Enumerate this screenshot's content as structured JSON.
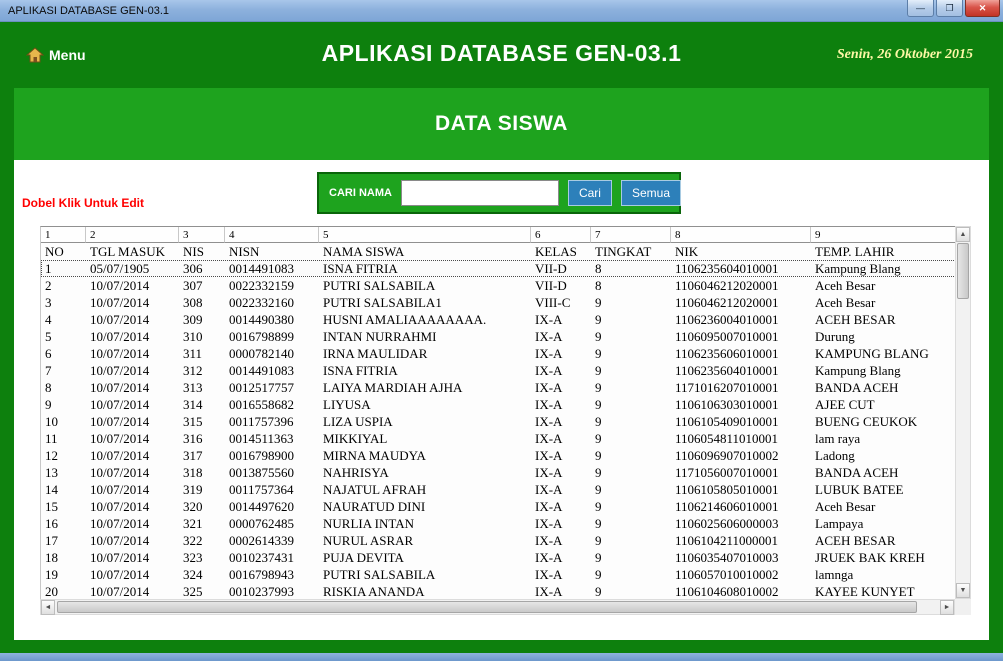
{
  "window": {
    "title": "APLIKASI DATABASE GEN-03.1",
    "controls": {
      "minimize": "—",
      "maximize": "❐",
      "close": "✕"
    }
  },
  "header": {
    "menu_label": "Menu",
    "title": "APLIKASI DATABASE GEN-03.1",
    "date": "Senin, 26 Oktober 2015"
  },
  "page": {
    "title": "DATA SISWA",
    "edit_hint": "Dobel Klik Untuk Edit"
  },
  "search": {
    "label": "CARI NAMA",
    "value": "",
    "buttons": {
      "cari": "Cari",
      "semua": "Semua"
    }
  },
  "icons": {
    "scroll_up": "▲",
    "scroll_down": "▼",
    "scroll_left": "◄",
    "scroll_right": "►"
  },
  "grid": {
    "column_numbers": [
      "1",
      "2",
      "3",
      "4",
      "5",
      "6",
      "7",
      "8",
      "9"
    ],
    "headers": [
      "NO",
      "TGL MASUK",
      "NIS",
      "NISN",
      "NAMA SISWA",
      "KELAS",
      "TINGKAT",
      "NIK",
      "TEMP. LAHIR"
    ],
    "rows": [
      [
        "1",
        "05/07/1905",
        "306",
        "0014491083",
        "ISNA FITRIA",
        "VII-D",
        "8",
        "1106235604010001",
        "Kampung Blang"
      ],
      [
        "2",
        "10/07/2014",
        "307",
        "0022332159",
        "PUTRI SALSABILA",
        "VII-D",
        "8",
        "1106046212020001",
        "Aceh Besar"
      ],
      [
        "3",
        "10/07/2014",
        "308",
        "0022332160",
        "PUTRI SALSABILA1",
        "VIII-C",
        "9",
        "1106046212020001",
        "Aceh Besar"
      ],
      [
        "4",
        "10/07/2014",
        "309",
        "0014490380",
        "HUSNI AMALIAAAAAAAA.",
        "IX-A",
        "9",
        "1106236004010001",
        "ACEH BESAR"
      ],
      [
        "5",
        "10/07/2014",
        "310",
        "0016798899",
        "INTAN NURRAHMI",
        "IX-A",
        "9",
        "1106095007010001",
        "Durung"
      ],
      [
        "6",
        "10/07/2014",
        "311",
        "0000782140",
        "IRNA MAULIDAR",
        "IX-A",
        "9",
        "1106235606010001",
        "KAMPUNG BLANG"
      ],
      [
        "7",
        "10/07/2014",
        "312",
        "0014491083",
        "ISNA FITRIA",
        "IX-A",
        "9",
        "1106235604010001",
        "Kampung Blang"
      ],
      [
        "8",
        "10/07/2014",
        "313",
        "0012517757",
        "LAIYA MARDIAH AJHA",
        "IX-A",
        "9",
        "1171016207010001",
        "BANDA ACEH"
      ],
      [
        "9",
        "10/07/2014",
        "314",
        "0016558682",
        "LIYUSA",
        "IX-A",
        "9",
        "1106106303010001",
        "AJEE CUT"
      ],
      [
        "10",
        "10/07/2014",
        "315",
        "0011757396",
        "LIZA USPIA",
        "IX-A",
        "9",
        "1106105409010001",
        "BUENG CEUKOK"
      ],
      [
        "11",
        "10/07/2014",
        "316",
        "0014511363",
        "MIKKIYAL",
        "IX-A",
        "9",
        "1106054811010001",
        "lam raya"
      ],
      [
        "12",
        "10/07/2014",
        "317",
        "0016798900",
        "MIRNA MAUDYA",
        "IX-A",
        "9",
        "1106096907010002",
        "Ladong"
      ],
      [
        "13",
        "10/07/2014",
        "318",
        "0013875560",
        "NAHRISYA",
        "IX-A",
        "9",
        "1171056007010001",
        "BANDA ACEH"
      ],
      [
        "14",
        "10/07/2014",
        "319",
        "0011757364",
        "NAJATUL AFRAH",
        "IX-A",
        "9",
        "1106105805010001",
        "LUBUK BATEE"
      ],
      [
        "15",
        "10/07/2014",
        "320",
        "0014497620",
        "NAURATUD DINI",
        "IX-A",
        "9",
        "1106214606010001",
        "Aceh Besar"
      ],
      [
        "16",
        "10/07/2014",
        "321",
        "0000762485",
        "NURLIA INTAN",
        "IX-A",
        "9",
        "1106025606000003",
        "Lampaya"
      ],
      [
        "17",
        "10/07/2014",
        "322",
        "0002614339",
        "NURUL ASRAR",
        "IX-A",
        "9",
        "1106104211000001",
        "ACEH BESAR"
      ],
      [
        "18",
        "10/07/2014",
        "323",
        "0010237431",
        "PUJA DEVITA",
        "IX-A",
        "9",
        "1106035407010003",
        "JRUEK BAK KREH"
      ],
      [
        "19",
        "10/07/2014",
        "324",
        "0016798943",
        "PUTRI SALSABILA",
        "IX-A",
        "9",
        "1106057010010002",
        "lamnga"
      ],
      [
        "20",
        "10/07/2014",
        "325",
        "0010237993",
        "RISKIA ANANDA",
        "IX-A",
        "9",
        "1106104608010002",
        "KAYEE KUNYET"
      ]
    ]
  },
  "colors": {
    "dark_green": "#0d800d",
    "light_green": "#1ea31e",
    "button_blue": "#2d80ba",
    "hint_red": "#ff0000",
    "date_yellow": "#fdf7a6",
    "close_red": "#c23325"
  }
}
